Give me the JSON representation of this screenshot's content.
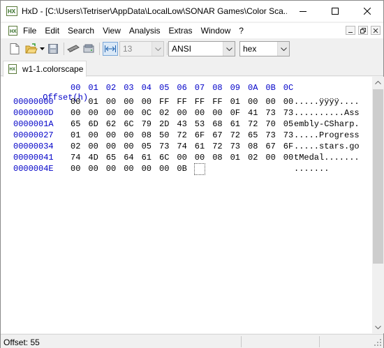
{
  "window": {
    "title": "HxD - [C:\\Users\\Tetriser\\AppData\\LocalLow\\SONAR Games\\Color Sca..."
  },
  "menu": {
    "items": [
      "File",
      "Edit",
      "Search",
      "View",
      "Analysis",
      "Extras",
      "Window",
      "?"
    ]
  },
  "toolbar": {
    "bytes_per_row": "13",
    "charset": "ANSI",
    "offset_base": "hex",
    "icons": [
      "new-file-icon",
      "open-folder-icon",
      "save-icon",
      "ram-icon",
      "disk-icon",
      "fit-width-icon"
    ]
  },
  "tab": {
    "label": "w1-1.colorscape"
  },
  "editor": {
    "header_label": "Offset(h)",
    "column_headers": [
      "00",
      "01",
      "02",
      "03",
      "04",
      "05",
      "06",
      "07",
      "08",
      "09",
      "0A",
      "0B",
      "0C"
    ],
    "rows": [
      {
        "offset": "00000000",
        "bytes": [
          "00",
          "01",
          "00",
          "00",
          "00",
          "FF",
          "FF",
          "FF",
          "FF",
          "01",
          "00",
          "00",
          "00"
        ],
        "ascii": ".....ÿÿÿÿ...."
      },
      {
        "offset": "0000000D",
        "bytes": [
          "00",
          "00",
          "00",
          "00",
          "0C",
          "02",
          "00",
          "00",
          "00",
          "0F",
          "41",
          "73",
          "73"
        ],
        "ascii": "..........Ass"
      },
      {
        "offset": "0000001A",
        "bytes": [
          "65",
          "6D",
          "62",
          "6C",
          "79",
          "2D",
          "43",
          "53",
          "68",
          "61",
          "72",
          "70",
          "05"
        ],
        "ascii": "embly-CSharp."
      },
      {
        "offset": "00000027",
        "bytes": [
          "01",
          "00",
          "00",
          "00",
          "08",
          "50",
          "72",
          "6F",
          "67",
          "72",
          "65",
          "73",
          "73"
        ],
        "ascii": ".....Progress"
      },
      {
        "offset": "00000034",
        "bytes": [
          "02",
          "00",
          "00",
          "00",
          "05",
          "73",
          "74",
          "61",
          "72",
          "73",
          "08",
          "67",
          "6F"
        ],
        "ascii": ".....stars.go"
      },
      {
        "offset": "00000041",
        "bytes": [
          "74",
          "4D",
          "65",
          "64",
          "61",
          "6C",
          "00",
          "00",
          "08",
          "01",
          "02",
          "00",
          "00"
        ],
        "ascii": "tMedal......."
      },
      {
        "offset": "0000004E",
        "bytes": [
          "00",
          "00",
          "00",
          "00",
          "00",
          "00",
          "0B",
          "",
          "",
          "",
          "",
          "",
          ""
        ],
        "ascii": "......."
      }
    ]
  },
  "status": {
    "offset_text": "Offset: 55"
  },
  "colors": {
    "offset_blue": "#0000c8",
    "title_bg": "#ffffff",
    "chrome_bg": "#f0f0f0"
  }
}
